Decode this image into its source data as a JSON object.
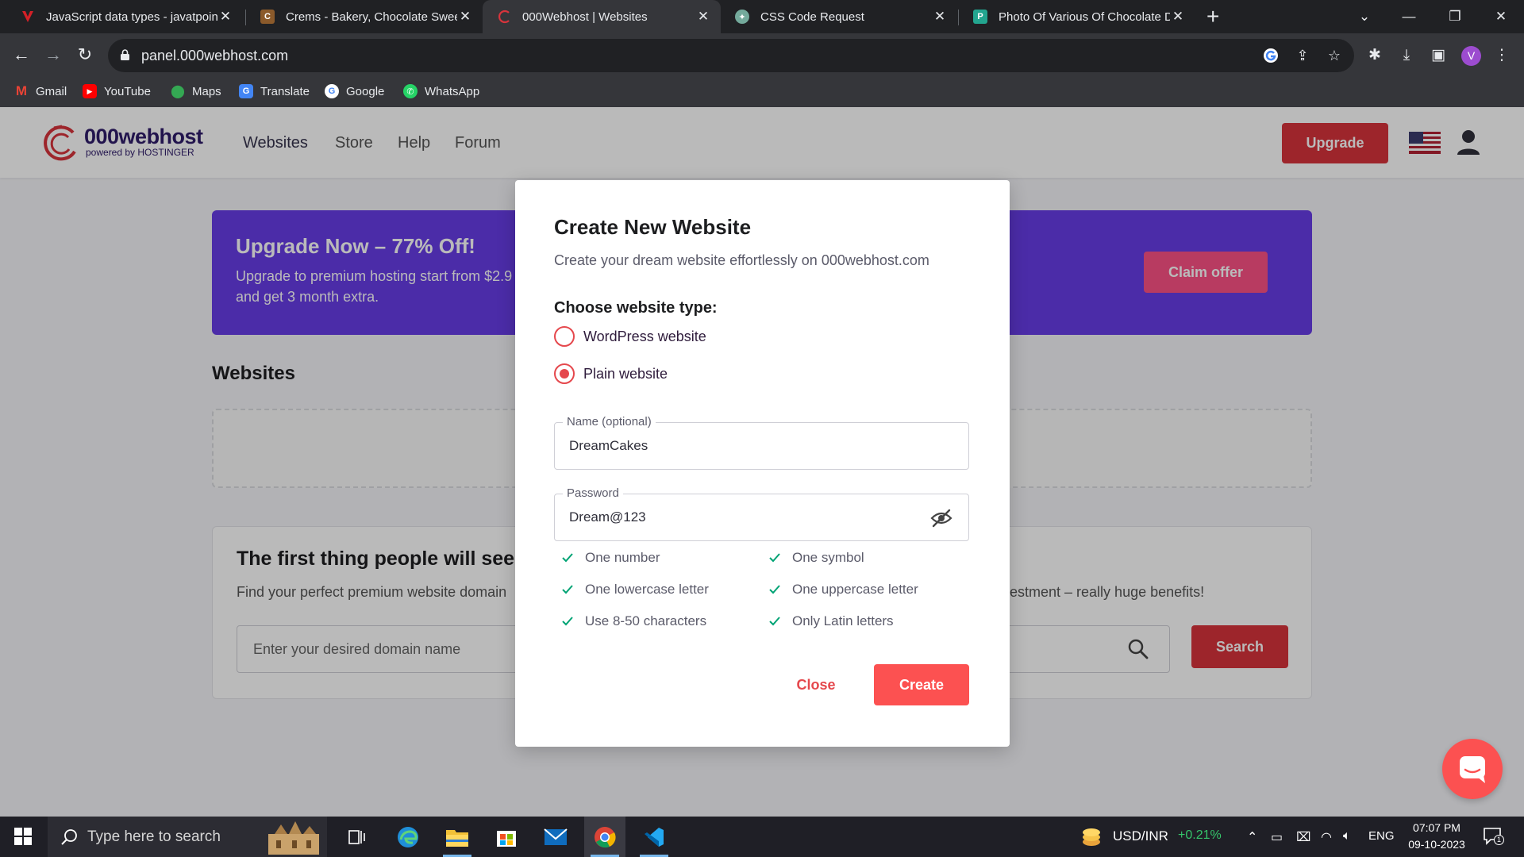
{
  "browser": {
    "tabs": [
      {
        "title": "JavaScript data types - javatpoin",
        "favicon_color": "#d32027",
        "active": false
      },
      {
        "title": "Crems - Bakery, Chocolate Swee",
        "favicon_color": "#8b5a2b",
        "active": false
      },
      {
        "title": "000Webhost | Websites",
        "favicon_color": "#d8343c",
        "active": true
      },
      {
        "title": "CSS Code Request",
        "favicon_color": "#74aa9c",
        "active": false
      },
      {
        "title": "Photo Of Various Of Chocolate D",
        "favicon_color": "#23a58f",
        "active": false
      }
    ],
    "url": "panel.000webhost.com",
    "profile_initial": "V",
    "bookmarks": [
      {
        "label": "Gmail",
        "icon": "gmail-icon",
        "color": "#ea4335"
      },
      {
        "label": "YouTube",
        "icon": "youtube-icon",
        "color": "#ff0000"
      },
      {
        "label": "Maps",
        "icon": "maps-icon",
        "color": "#34a853"
      },
      {
        "label": "Translate",
        "icon": "translate-icon",
        "color": "#4285f4"
      },
      {
        "label": "Google",
        "icon": "google-icon",
        "color": "#ffffff"
      },
      {
        "label": "WhatsApp",
        "icon": "whatsapp-icon",
        "color": "#25d366"
      }
    ]
  },
  "header": {
    "logo_text": "000webhost",
    "logo_sub": "powered by HOSTINGER",
    "nav": [
      "Websites",
      "Store",
      "Help",
      "Forum"
    ],
    "upgrade_label": "Upgrade"
  },
  "promo": {
    "title": "Upgrade Now – 77% Off!",
    "text_line1": "Upgrade to premium hosting start from $2.9",
    "text_line2": "and get 3 month extra.",
    "button": "Claim offer",
    "color": "#673de6"
  },
  "websites": {
    "title": "Websites"
  },
  "domain": {
    "title": "The first thing people will see",
    "text": "Find your perfect premium website domain",
    "text_tail": "estment – really huge benefits!",
    "placeholder": "Enter your desired domain name",
    "search_label": "Search"
  },
  "modal": {
    "title": "Create New Website",
    "subtitle": "Create your dream website effortlessly on 000webhost.com",
    "type_label": "Choose website type:",
    "options": [
      {
        "label": "WordPress website",
        "checked": false
      },
      {
        "label": "Plain website",
        "checked": true
      }
    ],
    "name_legend": "Name (optional)",
    "name_value": "DreamCakes",
    "password_legend": "Password",
    "password_value": "Dream@123",
    "rules": [
      "One number",
      "One symbol",
      "One lowercase letter",
      "One uppercase letter",
      "Use 8-50 characters",
      "Only Latin letters"
    ],
    "close_label": "Close",
    "create_label": "Create",
    "accent": "#fc5151"
  },
  "taskbar": {
    "search_placeholder": "Type here to search",
    "ticker": "USD/INR",
    "ticker_change": "+0.21%",
    "lang": "ENG",
    "time": "07:07 PM",
    "date": "09-10-2023",
    "notif_count": "1"
  }
}
